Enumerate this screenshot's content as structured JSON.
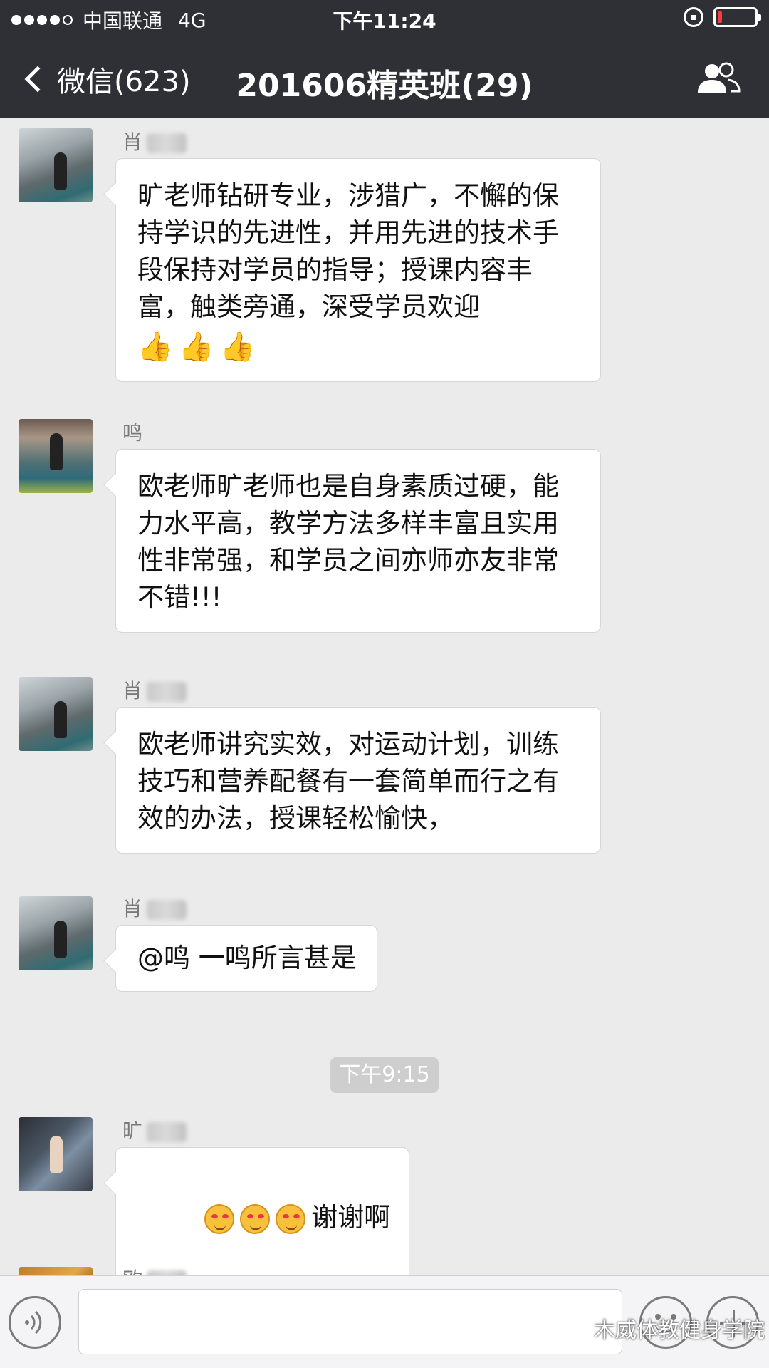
{
  "status_bar": {
    "carrier": "中国联通",
    "network": "4G",
    "time": "下午11:24",
    "battery_level": 0.12,
    "signal_strength": 4,
    "signal_max": 5
  },
  "nav": {
    "back_label": "微信(623)",
    "title": "201606精英班(29)"
  },
  "messages": [
    {
      "sender": "肖",
      "text": "旷老师钻研专业，涉猎广，不懈的保持学识的先进性，并用先进的技术手段保持对学员的指导；授课内容丰富，触类旁通，深受学员欢迎",
      "emoji": [
        "👍",
        "👍",
        "👍"
      ]
    },
    {
      "sender": "鸣",
      "text": "欧老师旷老师也是自身素质过硬，能力水平高，教学方法多样丰富且实用性非常强，和学员之间亦师亦友非常不错!!!"
    },
    {
      "sender": "肖",
      "text": "欧老师讲究实效，对运动计划，训练技巧和营养配餐有一套简单而行之有效的办法，授课轻松愉快，"
    },
    {
      "sender": "肖",
      "text": "@鸣 一鸣所言甚是"
    },
    {
      "sender": "旷",
      "text": "谢谢啊"
    },
    {
      "sender": "欧"
    }
  ],
  "timestamp": "下午9:15",
  "watermark": "木威体教健身学院",
  "colors": {
    "nav_bg": "#2f3036",
    "chat_bg": "#ebebeb",
    "battery_low": "#ff3a3a"
  }
}
